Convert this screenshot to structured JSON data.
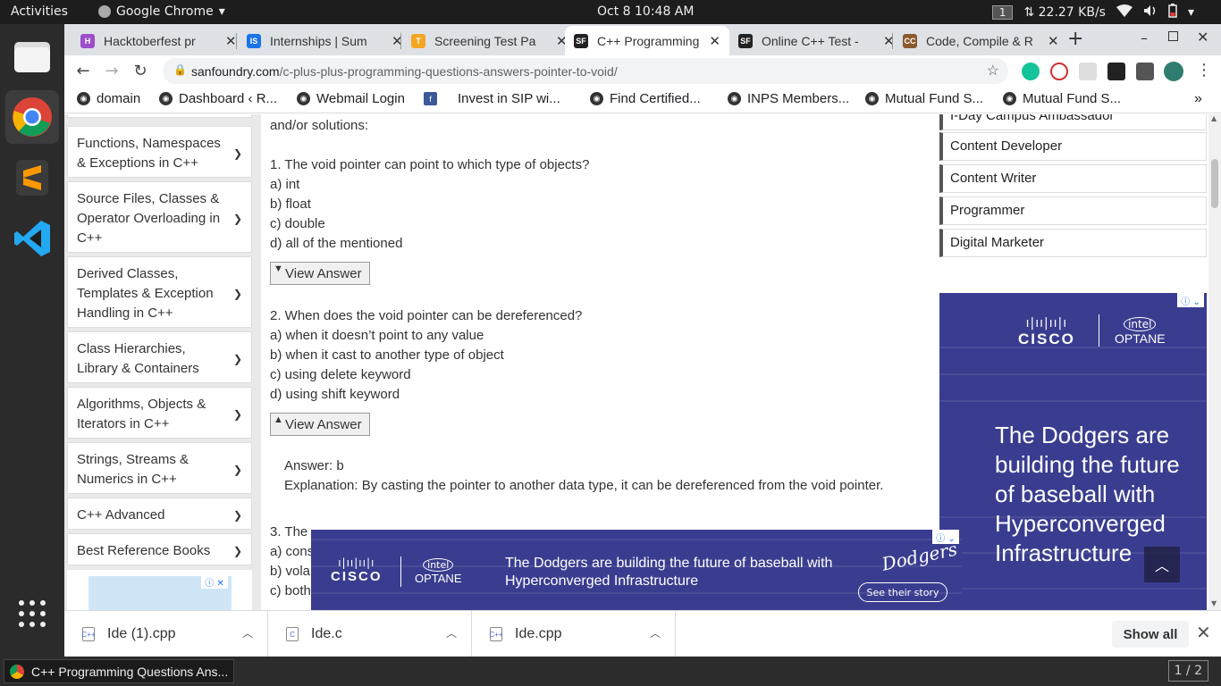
{
  "topbar": {
    "activities": "Activities",
    "app_name": "Google Chrome",
    "clock": "Oct 8  10:48 AM",
    "workspace_num": "1",
    "net_speed": "⇅ 22.27 KB/s"
  },
  "tabs": [
    {
      "label": "Hacktoberfest pr",
      "favicon_color": "#9c4dcc",
      "favicon_text": "H"
    },
    {
      "label": "Internships | Sum",
      "favicon_color": "#1a73e8",
      "favicon_text": "IS"
    },
    {
      "label": "Screening Test Pa",
      "favicon_color": "#f5a623",
      "favicon_text": "T"
    },
    {
      "label": "C++ Programming",
      "favicon_color": "#222222",
      "favicon_text": "SF"
    },
    {
      "label": "Online C++ Test -",
      "favicon_color": "#222222",
      "favicon_text": "SF"
    },
    {
      "label": "Code, Compile & R",
      "favicon_color": "#8b5a2b",
      "favicon_text": "CC"
    }
  ],
  "omnibox": {
    "domain": "sanfoundry.com",
    "path": "/c-plus-plus-programming-questions-answers-pointer-to-void/"
  },
  "bookmarks": [
    "domain",
    "Dashboard ‹ R...",
    "Webmail Login",
    "Invest in SIP wi...",
    "Find Certified...",
    "INPS Members...",
    "Mutual Fund S...",
    "Mutual Fund S..."
  ],
  "leftnav": [
    "Functions, Namespaces & Exceptions in C++",
    "Source Files, Classes & Operator Overloading in C++",
    "Derived Classes, Templates & Exception Handling in C++",
    "Class Hierarchies, Library & Containers",
    "Algorithms, Objects & Iterators in C++",
    "Strings, Streams & Numerics in C++",
    "C++ Advanced",
    "Best Reference Books"
  ],
  "content": {
    "intro": "and/or solutions:",
    "q1": "1. The void pointer can point to which type of objects?",
    "q1_options": [
      "a) int",
      "b) float",
      "c) double",
      "d) all of the mentioned"
    ],
    "view_answer": "View Answer",
    "q2": "2. When does the void pointer can be dereferenced?",
    "q2_options": [
      "a) when it doesn’t point to any value",
      "b) when it cast to another type of object",
      "c) using delete keyword",
      "d) using shift keyword"
    ],
    "answer": "Answer: b",
    "explanation": "Explanation: By casting the pointer to another data type, it can be dereferenced from the void pointer.",
    "q3_partial": "3. The",
    "q3_options_partial": [
      "a) cons",
      "b) vola",
      "c) both"
    ]
  },
  "jobs": [
    "I-Day Campus Ambassador",
    "Content Developer",
    "Content Writer",
    "Programmer",
    "Digital Marketer"
  ],
  "ad": {
    "brand1": "CISCO",
    "brand2": "OPTANE",
    "intel": "intel",
    "headline": "The Dodgers are building the future of baseball with Hyperconverged Infrastructure",
    "cta": "See their story",
    "team": "Dodgers"
  },
  "downloads": [
    {
      "name": "Ide (1).cpp",
      "icon": "C++"
    },
    {
      "name": "Ide.c",
      "icon": "C"
    },
    {
      "name": "Ide.cpp",
      "icon": "C++"
    }
  ],
  "downloads_show_all": "Show all",
  "taskbar": {
    "task": "C++ Programming Questions Ans...",
    "workspace": "1 / 2"
  }
}
